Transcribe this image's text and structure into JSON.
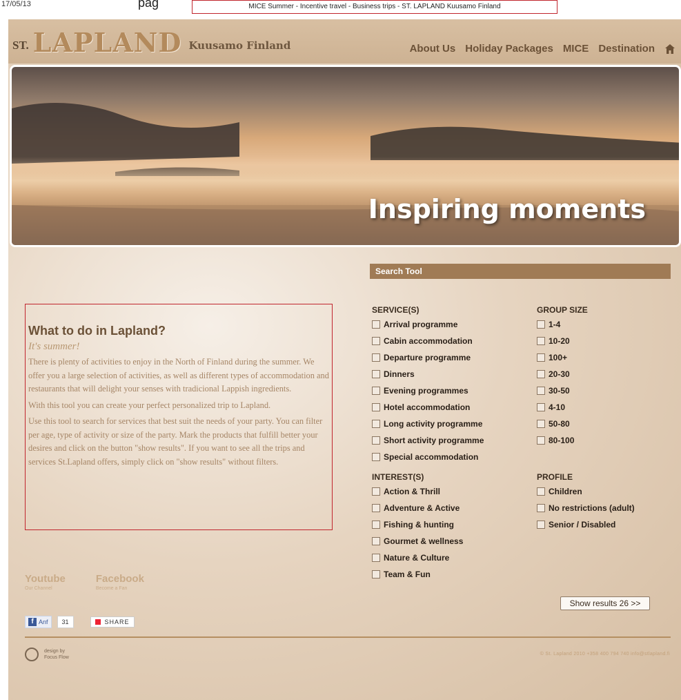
{
  "print_header": {
    "date": "17/05/13",
    "title": "MICE Summer - Incentive travel - Business trips - ST. LAPLAND Kuusamo Finland",
    "partial_word": "pag"
  },
  "brand": {
    "prefix": "ST.",
    "name": "LAPLAND",
    "location": "Kuusamo Finland"
  },
  "nav": {
    "items": [
      "About Us",
      "Holiday Packages",
      "MICE",
      "Destination"
    ],
    "home_icon": "home-icon"
  },
  "banner": {
    "caption": "Inspiring moments"
  },
  "search_tool": {
    "title": "Search Tool",
    "services": {
      "heading": "SERVICE(S)",
      "options": [
        "Arrival programme",
        "Cabin accommodation",
        "Departure programme",
        "Dinners",
        "Evening programmes",
        "Hotel accommodation",
        "Long activity programme",
        "Short activity programme",
        "Special accommodation"
      ]
    },
    "group_size": {
      "heading": "GROUP SIZE",
      "options": [
        "1-4",
        "10-20",
        "100+",
        "20-30",
        "30-50",
        "4-10",
        "50-80",
        "80-100"
      ]
    },
    "interests": {
      "heading": "INTEREST(S)",
      "options": [
        "Action & Thrill",
        "Adventure & Active",
        "Fishing & hunting",
        "Gourmet & wellness",
        "Nature & Culture",
        "Team & Fun"
      ]
    },
    "profile": {
      "heading": "PROFILE",
      "options": [
        "Children",
        "No restrictions (adult)",
        "Senior / Disabled"
      ]
    },
    "show_results_label": "Show results 26 >>"
  },
  "intro": {
    "title": "What to do in Lapland?",
    "subtitle": "It's summer!",
    "p1": "There is plenty of activities to enjoy in the North of Finland during the summer. We offer you a large selection of activities, as well as different types of accommodation and restaurants that will delight your senses with tradicional Lappish ingredients.",
    "p2": "With this tool you can create your perfect personalized trip to Lapland.",
    "p3": "Use this tool to search for services that best suit the needs of your party. You can filter per age, type of activity or size of the party. Mark the products that fulfill better your desires and click on the button \"show results\". If you want to see all the trips and services St.Lapland offers, simply click on \"show results\" without filters."
  },
  "social": {
    "youtube": {
      "title": "Youtube",
      "sub": "Our Channel"
    },
    "facebook": {
      "title": "Facebook",
      "sub": "Become a Fan"
    },
    "like_label": "Anf",
    "like_count": "31",
    "share_label": "SHARE"
  },
  "footer": {
    "design_line1": "design by",
    "design_line2": "Focus Flow",
    "contact": "© St. Lapland 2010   +358 400 794 740   info@stlapland.fi"
  },
  "colors": {
    "accent": "#a07b55",
    "nav_text": "#6b5137",
    "highlight_border": "#c0242c"
  }
}
